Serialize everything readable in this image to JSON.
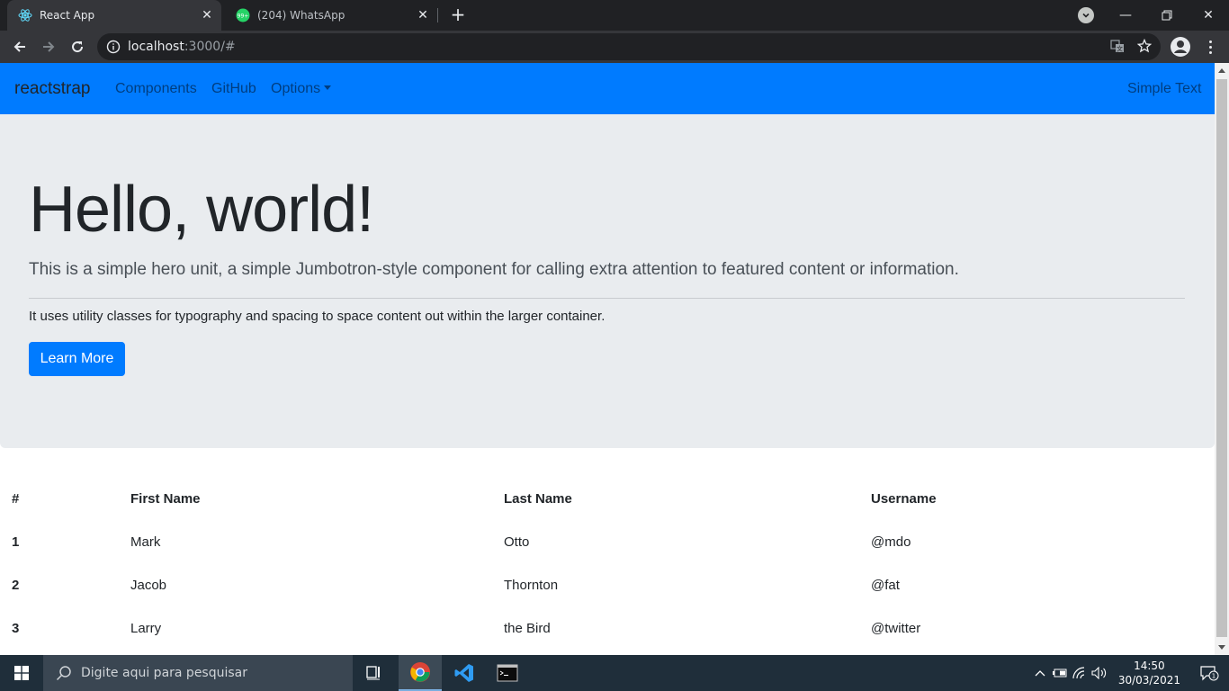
{
  "browser": {
    "tabs": [
      {
        "title": "React App",
        "active": true,
        "favicon": "react-icon"
      },
      {
        "title": "(204) WhatsApp",
        "active": false,
        "favicon": "whatsapp-icon",
        "badge": "99+"
      }
    ],
    "url_host": "localhost",
    "url_rest": ":3000/#"
  },
  "navbar": {
    "brand": "reactstrap",
    "links": [
      "Components",
      "GitHub",
      "Options"
    ],
    "right_text": "Simple Text",
    "bg_color": "#007bff"
  },
  "hero": {
    "title": "Hello, world!",
    "lead": "This is a simple hero unit, a simple Jumbotron-style component for calling extra attention to featured content or information.",
    "text": "It uses utility classes for typography and spacing to space content out within the larger container.",
    "button": "Learn More"
  },
  "table": {
    "headers": [
      "#",
      "First Name",
      "Last Name",
      "Username"
    ],
    "rows": [
      [
        "1",
        "Mark",
        "Otto",
        "@mdo"
      ],
      [
        "2",
        "Jacob",
        "Thornton",
        "@fat"
      ],
      [
        "3",
        "Larry",
        "the Bird",
        "@twitter"
      ]
    ]
  },
  "taskbar": {
    "search_placeholder": "Digite aqui para pesquisar",
    "time": "14:50",
    "date": "30/03/2021",
    "notifications": "1"
  }
}
